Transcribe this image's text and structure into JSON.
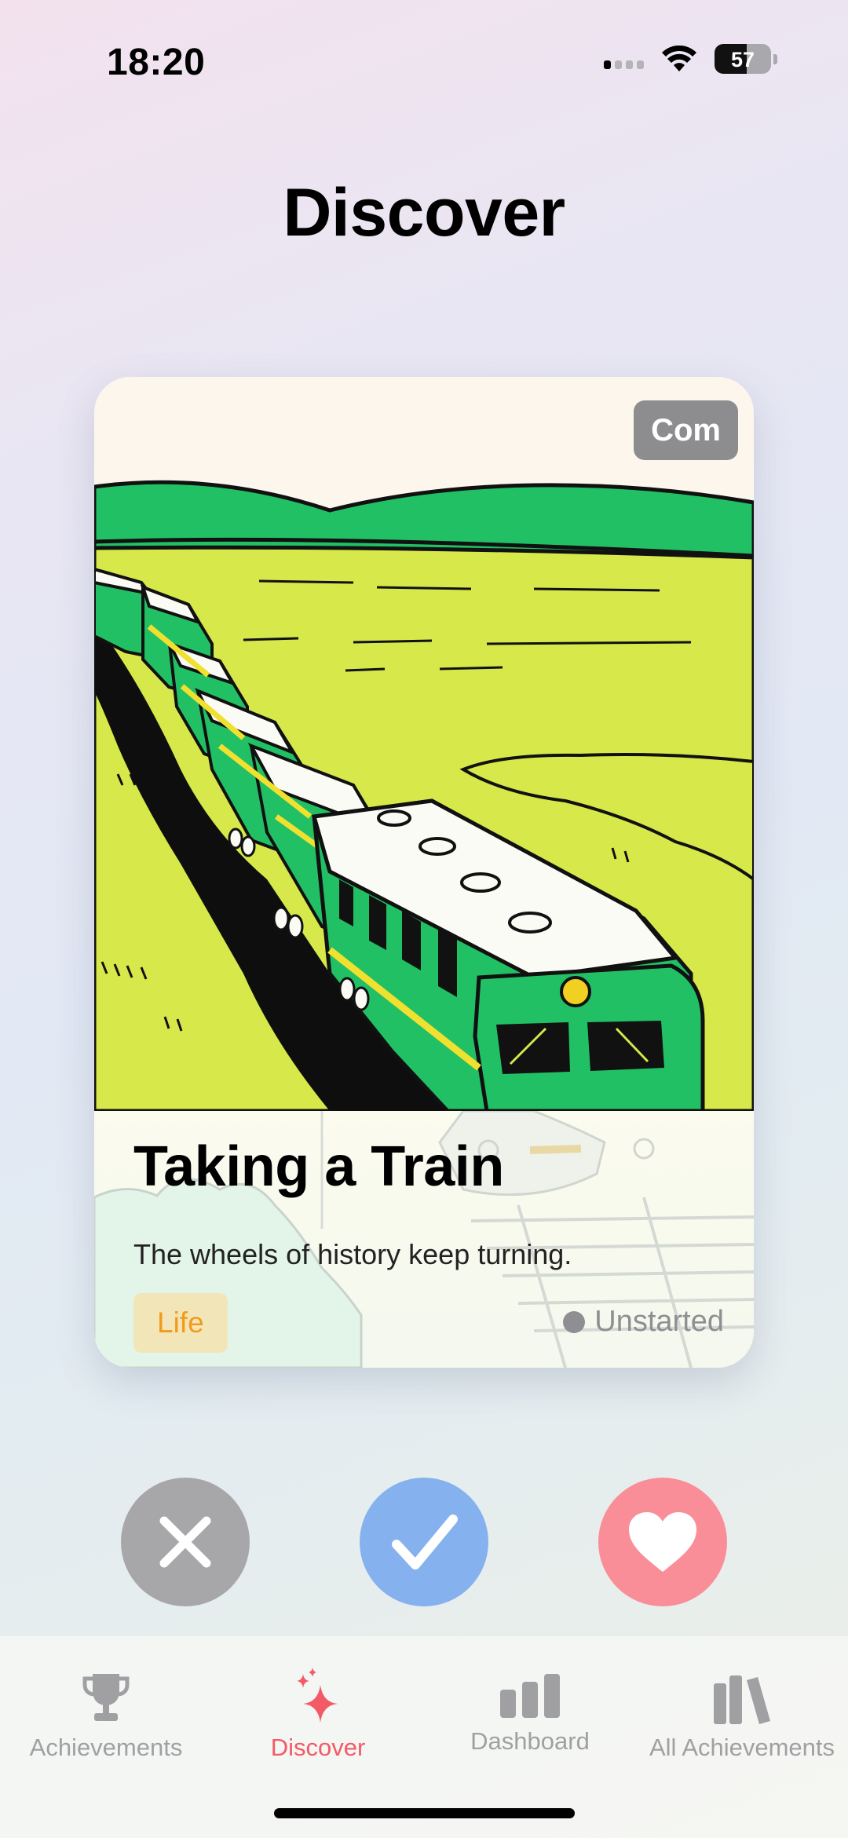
{
  "status_bar": {
    "time": "18:20",
    "battery_level": "57",
    "icons": [
      "cellular-signal-icon",
      "wifi-icon",
      "battery-icon"
    ]
  },
  "page": {
    "title": "Discover"
  },
  "card": {
    "badge": "Com",
    "title": "Taking a Train",
    "description": "The wheels of history keep turning.",
    "tag": "Life",
    "status": "Unstarted",
    "colors": {
      "tag_background": "#f2e6b8",
      "tag_text": "#f39a1a",
      "train_green": "#22c064",
      "grass": "#d6e84a"
    }
  },
  "actions": {
    "reject_icon": "close-icon",
    "accept_icon": "checkmark-icon",
    "like_icon": "heart-icon",
    "colors": {
      "reject": "#a7a7a9",
      "accept": "#85b1ef",
      "like": "#f98e98"
    }
  },
  "tab_bar": {
    "tabs": [
      {
        "label": "Achievements",
        "icon": "trophy-icon",
        "active": false
      },
      {
        "label": "Discover",
        "icon": "sparkles-icon",
        "active": true
      },
      {
        "label": "Dashboard",
        "icon": "bar-chart-icon",
        "active": false
      },
      {
        "label": "All Achievements",
        "icon": "books-icon",
        "active": false
      }
    ],
    "active_color": "#f25b66",
    "inactive_color": "#a0a0a3"
  }
}
